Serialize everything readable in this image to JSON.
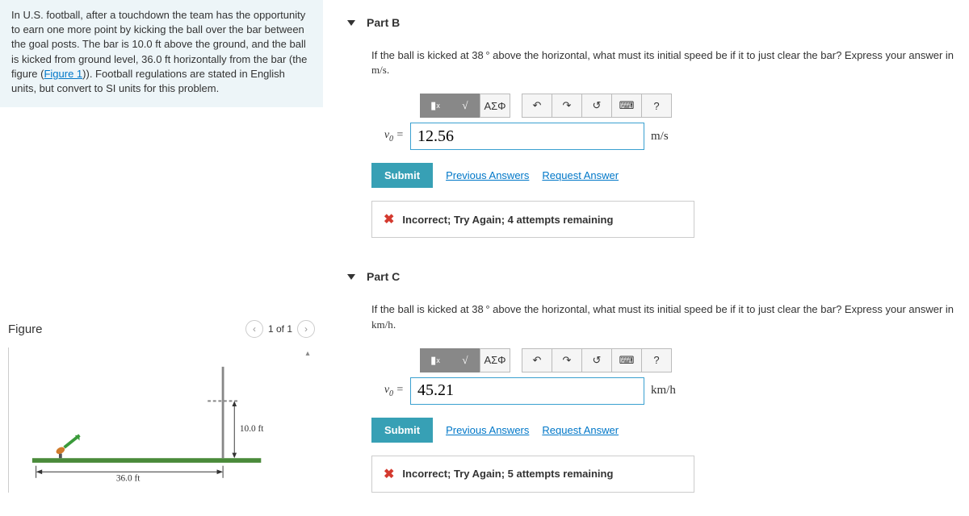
{
  "problem": {
    "text_before_link": "In U.S. football, after a touchdown the team has the opportunity to earn one more point by kicking the ball over the bar between the goal posts. The bar is 10.0 ft above the ground, and the ball is kicked from ground level, 36.0 ft horizontally from the bar (the figure (",
    "link_text": "Figure 1",
    "text_after_link": ")). Football regulations are stated in English units, but convert to SI units for this problem."
  },
  "figure": {
    "title": "Figure",
    "pager": "1 of 1",
    "height_label": "10.0 ft",
    "dist_label": "36.0 ft"
  },
  "toolbar": {
    "greek": "ΑΣΦ",
    "help": "?"
  },
  "actions": {
    "submit": "Submit",
    "previous": "Previous Answers",
    "request": "Request Answer"
  },
  "partB": {
    "title": "Part B",
    "question_prefix": "If the ball is kicked at 38",
    "question_suffix": " above the horizontal, what must its initial speed be if it to just clear the bar? Express your answer in ",
    "question_unit": "m/s",
    "var": "v",
    "value": "12.56",
    "unit": "m/s",
    "feedback": "Incorrect; Try Again; 4 attempts remaining"
  },
  "partC": {
    "title": "Part C",
    "question_prefix": "If the ball is kicked at 38",
    "question_suffix": " above the horizontal, what must its initial speed be if it to just clear the bar? Express your answer in ",
    "question_unit": "km/h",
    "var": "v",
    "value": "45.21",
    "unit": "km/h",
    "feedback": "Incorrect; Try Again; 5 attempts remaining"
  }
}
